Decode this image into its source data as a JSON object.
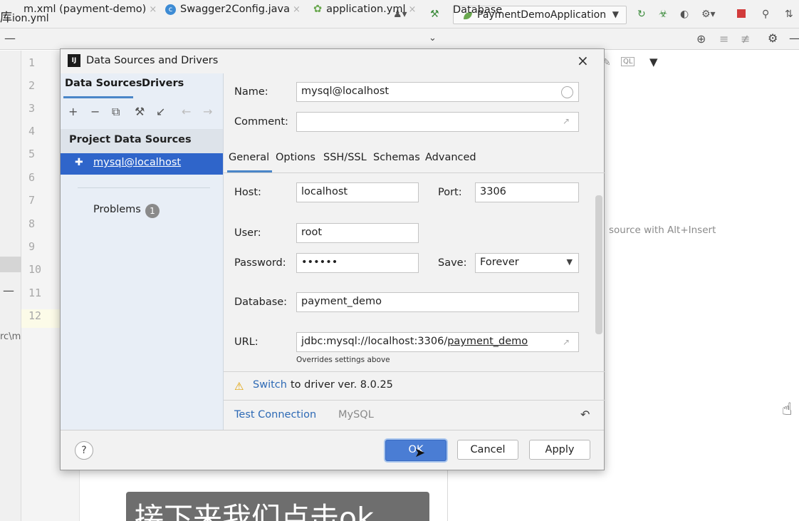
{
  "window": {
    "title": "ion.yml",
    "title_prefix": "库",
    "run_config": "PaymentDemoApplication"
  },
  "tabs": [
    {
      "label": "m.xml (payment-demo)"
    },
    {
      "label": "Swagger2Config.java"
    },
    {
      "label": "application.yml"
    }
  ],
  "right_panel": {
    "tab_label": "Database",
    "hint": "source with Alt+Insert"
  },
  "editor": {
    "line_numbers": [
      "1",
      "2",
      "3",
      "4",
      "5",
      "6",
      "7",
      "8",
      "9",
      "10",
      "11",
      "12"
    ],
    "left_clip_text": "rc\\m"
  },
  "dialog": {
    "title": "Data Sources and Drivers",
    "sidebar": {
      "tab_data_sources": "Data Sources",
      "tab_drivers": "Drivers",
      "section": "Project Data Sources",
      "selected_item": "mysql@localhost",
      "problems_label": "Problems",
      "problems_count": "1"
    },
    "form": {
      "name_label": "Name:",
      "name_value": "mysql@localhost",
      "comment_label": "Comment:",
      "comment_value": "",
      "tabs": [
        "General",
        "Options",
        "SSH/SSL",
        "Schemas",
        "Advanced"
      ],
      "host_label": "Host:",
      "host_value": "localhost",
      "port_label": "Port:",
      "port_value": "3306",
      "user_label": "User:",
      "user_value": "root",
      "password_label": "Password:",
      "password_value": "••••••",
      "save_label": "Save:",
      "save_value": "Forever",
      "database_label": "Database:",
      "database_value": "payment_demo",
      "url_label": "URL:",
      "url_value_prefix": "jdbc:mysql://localhost:3306/",
      "url_value_db": "payment_demo",
      "url_note": "Overrides settings above"
    },
    "warning": {
      "link": "Switch",
      "text": "to driver ver. 8.0.25"
    },
    "test_connection": "Test Connection",
    "driver_name": "MySQL",
    "buttons": {
      "help": "?",
      "ok": "OK",
      "cancel": "Cancel",
      "apply": "Apply"
    }
  },
  "subtitle": "接下来我们点击ok"
}
